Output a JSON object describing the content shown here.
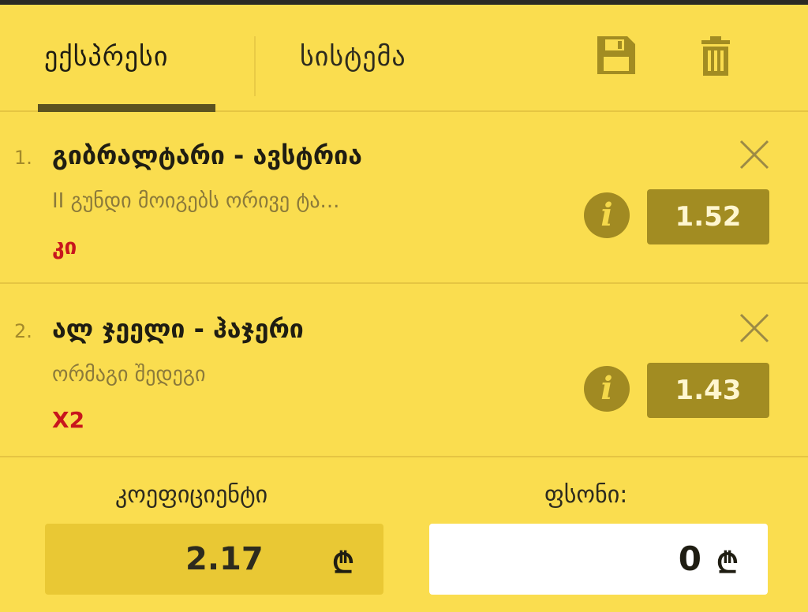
{
  "tabs": {
    "express_label": "ექსპრესი",
    "system_label": "სისტემა"
  },
  "header_icons": [
    "save-icon",
    "trash-icon"
  ],
  "bets": [
    {
      "number": "1.",
      "title": "გიბრალტარი - ავსტრია",
      "market": "II გუნდი მოიგებს ორივე ტა...",
      "pick": "კი",
      "odds": "1.52"
    },
    {
      "number": "2.",
      "title": "ალ ჯეელი - ჰაჯერი",
      "market": "ორმაგი შედეგი",
      "pick": "X2",
      "odds": "1.43"
    }
  ],
  "footer": {
    "coefficient_label": "კოეფიციენტი",
    "coefficient_value": "2.17",
    "stake_label": "ფსონი:",
    "stake_value": "0",
    "currency_symbol": "₾"
  },
  "colors": {
    "background": "#fadd4f",
    "accent_dark": "#a28c22",
    "pick_red": "#c8161d"
  }
}
